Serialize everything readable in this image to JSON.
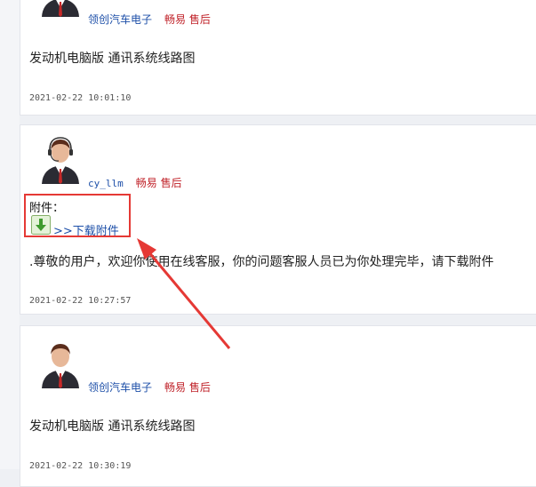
{
  "posts": [
    {
      "username": "领创汽车电子",
      "tag": "畅易 售后",
      "text": "发动机电脑版 通讯系统线路图",
      "timestamp": "2021-02-22 10:01:10"
    },
    {
      "username": "cy_llm",
      "tag": "畅易 售后",
      "attachment_label": "附件：",
      "attachment_link": ">>下载附件",
      "text": ".尊敬的用户，欢迎你使用在线客服，你的问题客服人员已为你处理完毕，请下载附件",
      "timestamp": "2021-02-22 10:27:57"
    },
    {
      "username": "领创汽车电子",
      "tag": "畅易 售后",
      "text": "发动机电脑版 通讯系统线路图",
      "timestamp": "2021-02-22 10:30:19"
    }
  ],
  "colors": {
    "username": "#1d4fa8",
    "tag": "#c0232a",
    "annotation": "#e53935"
  }
}
